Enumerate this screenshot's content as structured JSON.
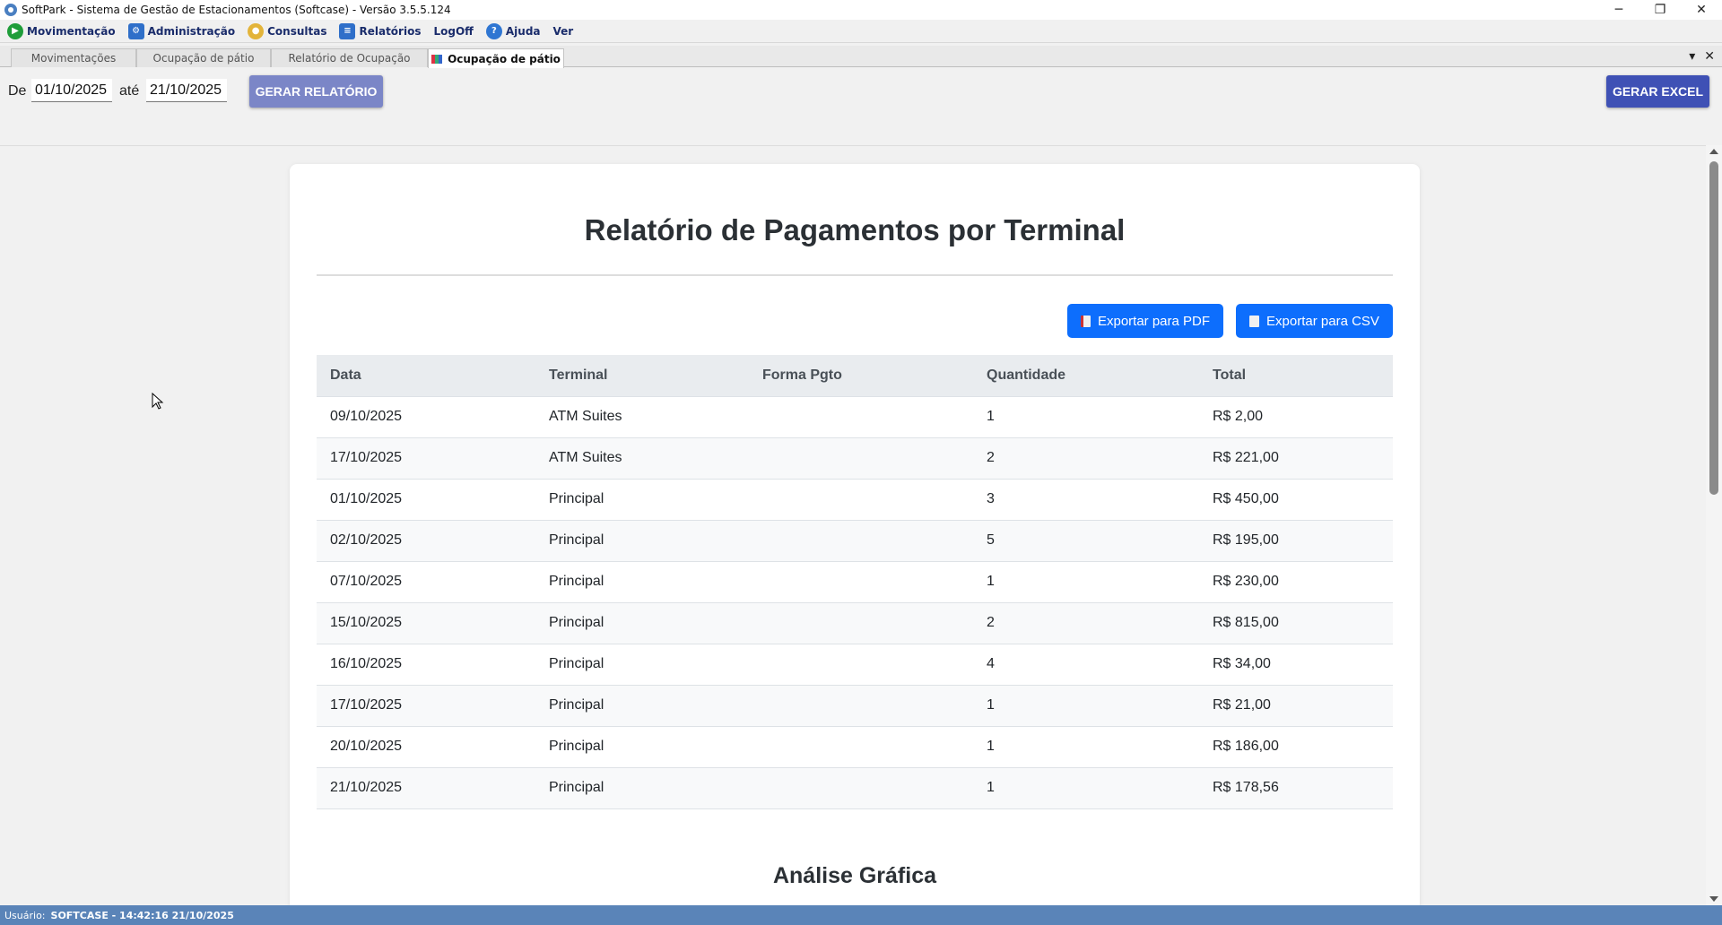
{
  "window": {
    "title": "SoftPark - Sistema de Gestão de Estacionamentos (Softcase) - Versão 3.5.5.124",
    "minimize": "─",
    "restore": "❐",
    "close": "✕"
  },
  "menu": [
    {
      "label": "Movimentação",
      "icon": "play-icon"
    },
    {
      "label": "Administração",
      "icon": "admin-icon"
    },
    {
      "label": "Consultas",
      "icon": "query-icon"
    },
    {
      "label": "Relatórios",
      "icon": "report-icon"
    },
    {
      "label": "LogOff",
      "icon": ""
    },
    {
      "label": "Ajuda",
      "icon": "help-icon"
    },
    {
      "label": "Ver",
      "icon": ""
    }
  ],
  "tabs": [
    {
      "label": "Movimentações"
    },
    {
      "label": "Ocupação de pátio"
    },
    {
      "label": "Relatório de Ocupação"
    },
    {
      "label": "Ocupação de pátio",
      "active": true
    }
  ],
  "tab_controls": {
    "dropdown": "▾",
    "close": "✕"
  },
  "filter": {
    "from_label": "De",
    "from_value": "01/10/2025",
    "to_label": "até",
    "to_value": "21/10/2025",
    "generate_report": "GERAR RELATÓRIO",
    "generate_excel": "GERAR EXCEL"
  },
  "colors": {
    "generate_report_bg": "#7b86c7",
    "generate_excel_bg": "#3f51b5",
    "export_bg": "#0d6efd",
    "statusbar_bg": "#5a84b8"
  },
  "report": {
    "title": "Relatório de Pagamentos por Terminal",
    "export_pdf": "Exportar para PDF",
    "export_csv": "Exportar para CSV",
    "columns": [
      "Data",
      "Terminal",
      "Forma Pgto",
      "Quantidade",
      "Total"
    ],
    "rows": [
      [
        "09/10/2025",
        "ATM Suites",
        "",
        "1",
        "R$ 2,00"
      ],
      [
        "17/10/2025",
        "ATM Suites",
        "",
        "2",
        "R$ 221,00"
      ],
      [
        "01/10/2025",
        "Principal",
        "",
        "3",
        "R$ 450,00"
      ],
      [
        "02/10/2025",
        "Principal",
        "",
        "5",
        "R$ 195,00"
      ],
      [
        "07/10/2025",
        "Principal",
        "",
        "1",
        "R$ 230,00"
      ],
      [
        "15/10/2025",
        "Principal",
        "",
        "2",
        "R$ 815,00"
      ],
      [
        "16/10/2025",
        "Principal",
        "",
        "4",
        "R$ 34,00"
      ],
      [
        "17/10/2025",
        "Principal",
        "",
        "1",
        "R$ 21,00"
      ],
      [
        "20/10/2025",
        "Principal",
        "",
        "1",
        "R$ 186,00"
      ],
      [
        "21/10/2025",
        "Principal",
        "",
        "1",
        "R$ 178,56"
      ]
    ],
    "chart_section_title": "Análise Gráfica"
  },
  "status": {
    "user_label": "Usuário:",
    "user_info": "SOFTCASE - 14:42:16 21/10/2025"
  }
}
